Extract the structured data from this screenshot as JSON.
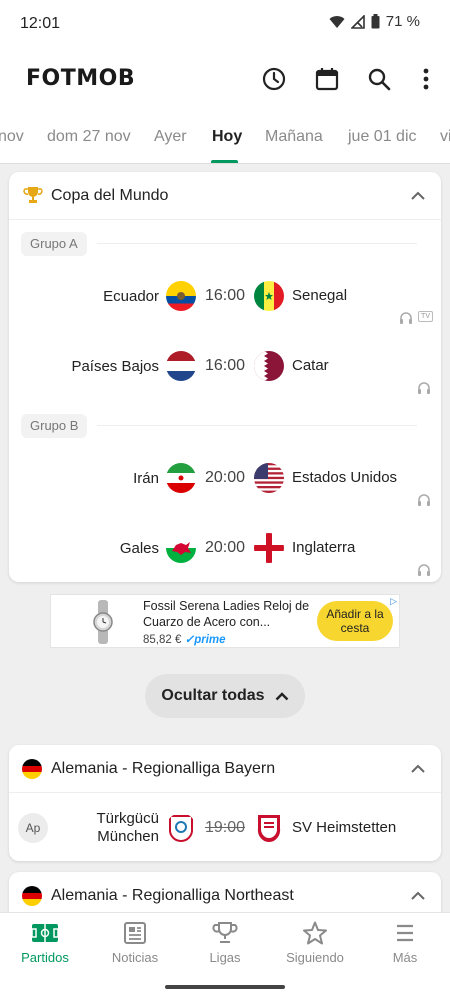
{
  "status_bar": {
    "time": "12:01",
    "battery": "71 %"
  },
  "app": {
    "logo": "FOTMOB"
  },
  "toolbar": {
    "icons": [
      "clock-icon",
      "calendar-icon",
      "search-icon",
      "more-vert-icon"
    ]
  },
  "date_tabs": [
    {
      "label": "nov",
      "active": false
    },
    {
      "label": "dom 27 nov",
      "active": false
    },
    {
      "label": "Ayer",
      "active": false
    },
    {
      "label": "Hoy",
      "active": true
    },
    {
      "label": "Mañana",
      "active": false
    },
    {
      "label": "jue 01 dic",
      "active": false
    },
    {
      "label": "vi",
      "active": false
    }
  ],
  "world_cup": {
    "title": "Copa del Mundo",
    "groups": [
      {
        "name": "Grupo A",
        "matches": [
          {
            "home": "Ecuador",
            "time": "16:00",
            "away": "Senegal",
            "tv": "TV"
          },
          {
            "home": "Países Bajos",
            "time": "16:00",
            "away": "Catar"
          }
        ]
      },
      {
        "name": "Grupo B",
        "matches": [
          {
            "home": "Irán",
            "time": "20:00",
            "away": "Estados Unidos"
          },
          {
            "home": "Gales",
            "time": "20:00",
            "away": "Inglaterra"
          }
        ]
      }
    ]
  },
  "ad": {
    "title": "Fossil Serena Ladies Reloj de Cuarzo de Acero con...",
    "price": "85,82 €",
    "prime": "prime",
    "cta": "Añadir a la cesta"
  },
  "hide_all": {
    "label": "Ocultar todas"
  },
  "leagues": [
    {
      "title": "Alemania - Regionalliga Bayern",
      "matches": [
        {
          "status": "Ap",
          "home": "Türkgücü München",
          "time": "19:00",
          "away": "SV Heimstetten"
        }
      ]
    },
    {
      "title": "Alemania - Regionalliga Northeast"
    }
  ],
  "bottom_nav": [
    {
      "label": "Partidos",
      "active": true
    },
    {
      "label": "Noticias",
      "active": false
    },
    {
      "label": "Ligas",
      "active": false
    },
    {
      "label": "Siguiendo",
      "active": false
    },
    {
      "label": "Más",
      "active": false
    }
  ],
  "colors": {
    "accent": "#00985f",
    "cta": "#f7d630",
    "trophy": "#e6a817"
  }
}
